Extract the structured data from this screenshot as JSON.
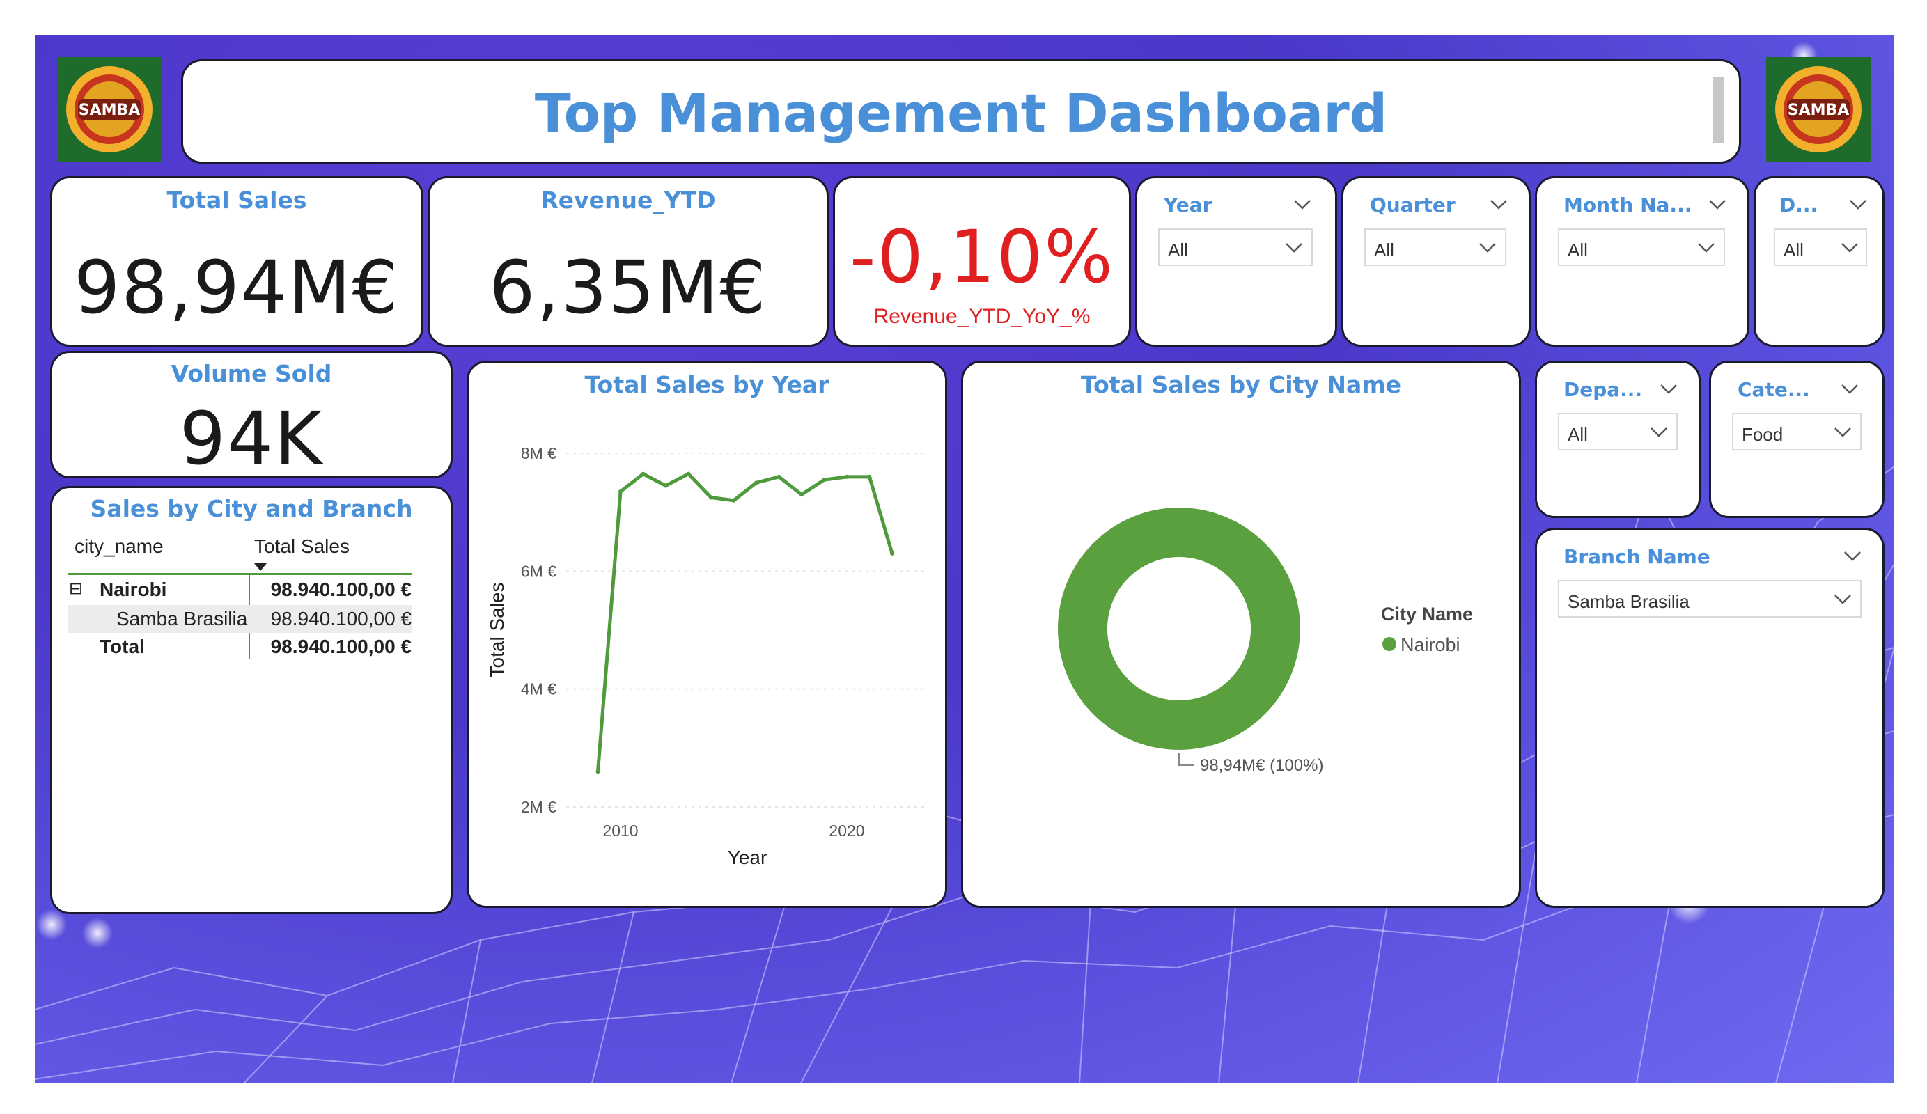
{
  "header": {
    "title": "Top Management Dashboard"
  },
  "logos": {
    "text_top": "SAMBA",
    "text_bottom": "SAMBA",
    "color": "#1f6b2c"
  },
  "kpis": {
    "total_sales": {
      "label": "Total Sales",
      "value": "98,94M€"
    },
    "revenue_ytd": {
      "label": "Revenue_YTD",
      "value": "6,35M€"
    },
    "revenue_yoy": {
      "label": "Revenue_YTD_YoY_%",
      "value": "-0,10%",
      "color": "#e02020"
    },
    "volume_sold": {
      "label": "Volume Sold",
      "value": "94K"
    }
  },
  "slicers": {
    "year": {
      "title": "Year",
      "value": "All"
    },
    "quarter": {
      "title": "Quarter",
      "value": "All"
    },
    "month": {
      "title": "Month Na...",
      "value": "All"
    },
    "day": {
      "title": "D...",
      "value": "All"
    },
    "department": {
      "title": "Depa...",
      "value": "All"
    },
    "category": {
      "title": "Cate...",
      "value": "Food"
    },
    "branch": {
      "title": "Branch Name",
      "value": "Samba Brasilia"
    }
  },
  "table": {
    "title": "Sales by City and Branch",
    "headers": [
      "city_name",
      "Total Sales"
    ],
    "rows": [
      {
        "name": "Nairobi",
        "value": "98.940.100,00 €"
      },
      {
        "name": "Samba Brasilia",
        "value": "98.940.100,00 €"
      },
      {
        "name": "Total",
        "value": "98.940.100,00 €"
      }
    ],
    "expand_symbol": "⊟"
  },
  "line_chart": {
    "title": "Total Sales by Year",
    "chart_data": {
      "type": "line",
      "x": [
        2009,
        2010,
        2011,
        2012,
        2013,
        2014,
        2015,
        2016,
        2017,
        2018,
        2019,
        2020,
        2021,
        2022
      ],
      "values": [
        2.6,
        7.35,
        7.65,
        7.45,
        7.65,
        7.25,
        7.2,
        7.5,
        7.6,
        7.3,
        7.55,
        7.6,
        7.6,
        6.3
      ],
      "xlabel": "Year",
      "ylabel": "Total Sales",
      "yticks": [
        "2M €",
        "4M €",
        "6M €",
        "8M €"
      ],
      "xticks": [
        "2010",
        "2020"
      ],
      "ylim": [
        2,
        8
      ],
      "color": "#4e9a3c"
    }
  },
  "donut_chart": {
    "title": "Total Sales by City Name",
    "chart_data": {
      "type": "pie",
      "categories": [
        "Nairobi"
      ],
      "values": [
        100
      ],
      "data_label": "98,94M€ (100%)",
      "legend_title": "City Name",
      "color": "#5aa03e"
    }
  }
}
